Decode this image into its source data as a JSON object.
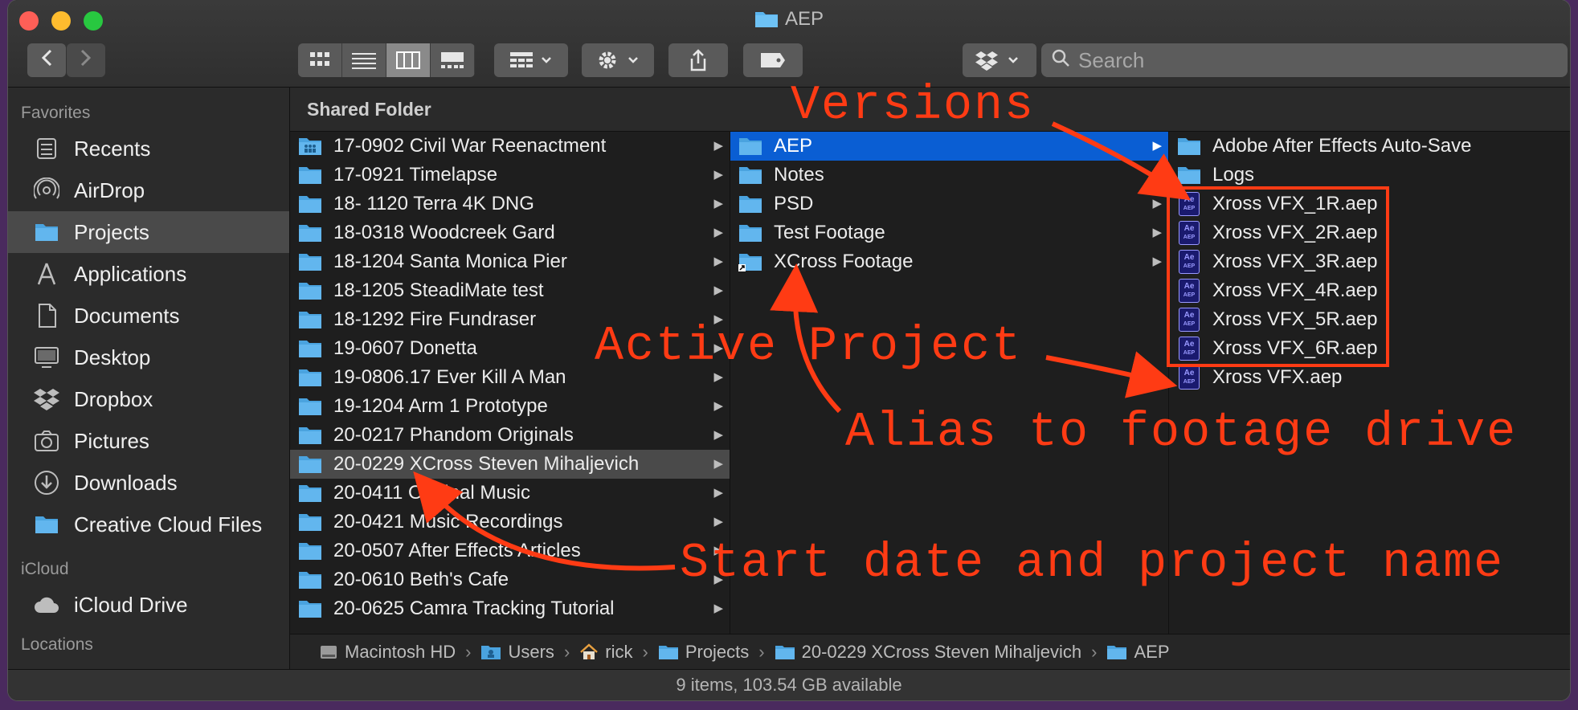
{
  "window": {
    "title": "AEP"
  },
  "toolbar": {
    "search_placeholder": "Search"
  },
  "sidebar": {
    "favorites_heading": "Favorites",
    "favorites": [
      {
        "label": "Recents",
        "icon": "clock-icon"
      },
      {
        "label": "AirDrop",
        "icon": "airdrop-icon"
      },
      {
        "label": "Projects",
        "icon": "folder-icon",
        "selected": true
      },
      {
        "label": "Applications",
        "icon": "applications-icon"
      },
      {
        "label": "Documents",
        "icon": "document-icon"
      },
      {
        "label": "Desktop",
        "icon": "desktop-icon"
      },
      {
        "label": "Dropbox",
        "icon": "dropbox-icon"
      },
      {
        "label": "Pictures",
        "icon": "camera-icon"
      },
      {
        "label": "Downloads",
        "icon": "download-icon"
      },
      {
        "label": "Creative Cloud Files",
        "icon": "folder-icon"
      }
    ],
    "icloud_heading": "iCloud",
    "icloud": [
      {
        "label": "iCloud Drive",
        "icon": "cloud-icon"
      }
    ],
    "locations_heading": "Locations"
  },
  "columns": {
    "header": "Shared Folder",
    "col1": [
      "17-0902 Civil War Reenactment",
      "17-0921 Timelapse",
      "18- 1120 Terra 4K DNG",
      "18-0318 Woodcreek Gard",
      "18-1204 Santa Monica Pier",
      "18-1205 SteadiMate test",
      "18-1292 Fire Fundraser",
      "19-0607 Donetta",
      "19-0806.17 Ever Kill A Man",
      "19-1204 Arm 1 Prototype",
      "20-0217 Phandom Originals",
      "20-0229 XCross  Steven Mihaljevich",
      "20-0411 Original Music",
      "20-0421 Music Recordings",
      "20-0507 After Effects Articles",
      "20-0610 Beth's Cafe",
      "20-0625 Camra Tracking Tutorial"
    ],
    "col2": [
      "AEP",
      "Notes",
      "PSD",
      "Test Footage",
      "XCross Footage"
    ],
    "col3": [
      "Adobe After Effects Auto-Save",
      "Logs",
      "Xross VFX_1R.aep",
      "Xross VFX_2R.aep",
      "Xross VFX_3R.aep",
      "Xross VFX_4R.aep",
      "Xross VFX_5R.aep",
      "Xross VFX_6R.aep",
      "Xross VFX.aep"
    ],
    "aep_icon_text": [
      "Ae",
      "AEP"
    ]
  },
  "pathbar": [
    "Macintosh HD",
    "Users",
    "rick",
    "Projects",
    "20-0229 XCross  Steven Mihaljevich",
    "AEP"
  ],
  "status": "9 items, 103.54 GB available",
  "annotations": {
    "versions": "Versions",
    "active_project": "Active Project",
    "alias": "Alias to footage drive",
    "start_date": "Start date and project name",
    "color": "#ff3b14"
  }
}
